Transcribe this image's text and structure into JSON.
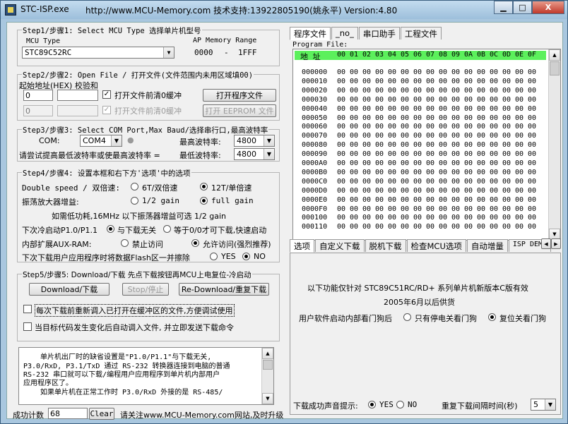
{
  "window": {
    "app_title": "STC-ISP.exe",
    "url_title": "http://www.MCU-Memory.com 技术支持:13922805190(姚永平) Version:4.80",
    "min_glyph": "▁",
    "max_glyph": "□",
    "close_glyph": "X"
  },
  "step1": {
    "title": "Step1/步骤1: Select MCU Type  选择单片机型号",
    "mcu_type_label": "MCU Type",
    "mcu_value": "STC89C52RC",
    "ap_label": "AP Memory Range",
    "ap_start": "0000",
    "ap_dash": "-",
    "ap_end": "1FFF"
  },
  "step2": {
    "title": "Step2/步骤2: Open File / 打开文件(文件范围内未用区域填00)",
    "addr_label": "起始地址(HEX) 校验和",
    "addr1": "0",
    "addr2": "0",
    "clear_buffer_label": "打开文件前清0缓冲",
    "clear_buffer2_label": "打开文件前清0缓冲",
    "open_program_btn": "打开程序文件",
    "open_eeprom_btn": "打开 EEPROM 文件"
  },
  "step3": {
    "title": "Step3/步骤3: Select COM Port,Max Baud/选择串行口,最高波特率",
    "com_label": "COM:",
    "com_value": "COM4",
    "max_baud_label": "最高波特率:",
    "max_baud_value": "4800",
    "try_label": "请尝试提高最低波特率或使最高波特率 =",
    "min_baud_label": "最低波特率:",
    "min_baud_value": "4800"
  },
  "step4": {
    "title": "Step4/步骤4: 设置本框和右下方'选项'中的选项",
    "double_speed_label": "Double speed / 双倍速:",
    "opt_6t": "6T/双倍速",
    "opt_12t": "12T/单倍速",
    "amp_label": "振荡放大器增益:",
    "opt_half": "1/2 gain",
    "opt_full": "full gain",
    "note": "如需低功耗,16MHz 以下振荡器增益可选 1/2 gain",
    "next_boot_label": "下次冷启动P1.0/P1.1",
    "opt_unrelated": "与下载无关",
    "opt_00": "等于0/0才可下载,快速启动",
    "aux_label": "内部扩展AUX-RAM:",
    "opt_forbid": "禁止访问",
    "opt_allow": "允许访问(强烈推荐)",
    "erase_label": "下次下载用户应用程序时将数据Flash区一并擦除",
    "opt_yes": "YES",
    "opt_no": "NO"
  },
  "step5": {
    "title": "Step5/步骤5: Download/下载  先点下载按钮再MCU上电复位-冷启动",
    "download_btn": "Download/下载",
    "stop_btn": "Stop/停止",
    "redownload_btn": "Re-Download/重复下载",
    "reload_label": "每次下载前重新调入已打开在缓冲区的文件,方便调试使用",
    "auto_label": "当目标代码发生变化后自动调入文件, 并立即发送下载命令"
  },
  "info_text": {
    "line1": "单片机出厂时的缺省设置是\"P1.0/P1.1\"与下载无关,",
    "line2": "P3.0/RxD, P3.1/TxD 通过 RS-232 转换器连接到电脑的普通",
    "line3": "RS-232 串口就可以下载/编程用户应用程序到单片机内部用户",
    "line4": "应用程序区了。",
    "line5": "如果单片机在正常工作时 P3.0/RxD 外接的是 RS-485/"
  },
  "statusbar": {
    "count_label": "成功计数",
    "count_value": "68",
    "clear_btn": "Clear",
    "notice": "请关注www.MCU-Memory.com网站,及时升级"
  },
  "top_tabs": [
    "程序文件",
    "_no_",
    "串口助手",
    "工程文件"
  ],
  "hex": {
    "program_file_label": "Program File:",
    "addr_header": "地 址",
    "col_headers": [
      "00",
      "01",
      "02",
      "03",
      "04",
      "05",
      "06",
      "07",
      "08",
      "09",
      "0A",
      "0B",
      "0C",
      "0D",
      "0E",
      "0F"
    ],
    "rows": [
      "000000",
      "000010",
      "000020",
      "000030",
      "000040",
      "000050",
      "000060",
      "000070",
      "000080",
      "000090",
      "0000A0",
      "0000B0",
      "0000C0",
      "0000D0",
      "0000E0",
      "0000F0",
      "000100",
      "000110"
    ],
    "cell_value": "00"
  },
  "bottom_tabs": [
    "选项",
    "自定义下载",
    "脱机下载",
    "检查MCU选项",
    "自动增量",
    "ISP DEMC"
  ],
  "options": {
    "line1": "以下功能仅针对 STC89C51RC/RD+ 系列单片机新版本C版有效",
    "line2": "2005年6月以后供货",
    "watchdog_label": "用户软件启动内部看门狗后",
    "opt_power": "只有停电关看门狗",
    "opt_reset": "复位关看门狗",
    "sound_label": "下载成功声音提示:",
    "sound_yes": "YES",
    "sound_no": "NO",
    "repeat_label": "重复下载间隔时间(秒)",
    "repeat_value": "5"
  },
  "colors": {
    "hex_header_bg": "#5cf05c",
    "window_frame": "#a9c7df"
  }
}
